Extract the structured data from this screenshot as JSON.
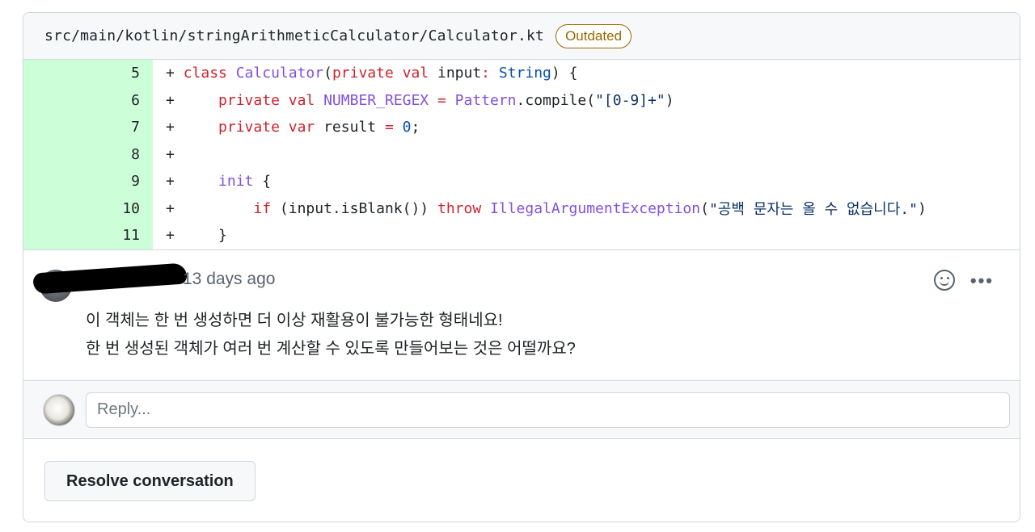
{
  "file": {
    "path": "src/main/kotlin/stringArithmeticCalculator/Calculator.kt",
    "badge": "Outdated"
  },
  "diff": {
    "lines": [
      {
        "number": "5",
        "sign": "+",
        "tokens": [
          {
            "t": "k",
            "v": "class "
          },
          {
            "t": "t",
            "v": "Calculator"
          },
          {
            "t": "p",
            "v": "("
          },
          {
            "t": "k",
            "v": "private val "
          },
          {
            "t": "p",
            "v": "input"
          },
          {
            "t": "k",
            "v": ": "
          },
          {
            "t": "c",
            "v": "String"
          },
          {
            "t": "p",
            "v": ") {"
          }
        ]
      },
      {
        "number": "6",
        "sign": "+",
        "tokens": [
          {
            "t": "p",
            "v": "    "
          },
          {
            "t": "k",
            "v": "private val "
          },
          {
            "t": "t",
            "v": "NUMBER_REGEX"
          },
          {
            "t": "k",
            "v": " = "
          },
          {
            "t": "t",
            "v": "Pattern"
          },
          {
            "t": "p",
            "v": ".compile("
          },
          {
            "t": "s",
            "v": "\"[0-9]+\""
          },
          {
            "t": "p",
            "v": ")"
          }
        ]
      },
      {
        "number": "7",
        "sign": "+",
        "tokens": [
          {
            "t": "p",
            "v": "    "
          },
          {
            "t": "k",
            "v": "private var "
          },
          {
            "t": "p",
            "v": "result "
          },
          {
            "t": "k",
            "v": "= "
          },
          {
            "t": "c",
            "v": "0"
          },
          {
            "t": "p",
            "v": ";"
          }
        ]
      },
      {
        "number": "8",
        "sign": "+",
        "tokens": []
      },
      {
        "number": "9",
        "sign": "+",
        "tokens": [
          {
            "t": "p",
            "v": "    "
          },
          {
            "t": "t",
            "v": "init"
          },
          {
            "t": "p",
            "v": " {"
          }
        ]
      },
      {
        "number": "10",
        "sign": "+",
        "tokens": [
          {
            "t": "p",
            "v": "        "
          },
          {
            "t": "k",
            "v": "if"
          },
          {
            "t": "p",
            "v": " (input.isBlank()) "
          },
          {
            "t": "k",
            "v": "throw "
          },
          {
            "t": "t",
            "v": "IllegalArgumentException"
          },
          {
            "t": "p",
            "v": "("
          },
          {
            "t": "s",
            "v": "\"공백 문자는 올 수 없습니다.\""
          },
          {
            "t": "p",
            "v": ")"
          }
        ]
      },
      {
        "number": "11",
        "sign": "+",
        "tokens": [
          {
            "t": "p",
            "v": "    }"
          }
        ]
      }
    ]
  },
  "comment": {
    "time": "13 days ago",
    "line1": "이 객체는 한 번 생성하면 더 이상 재활용이 불가능한 형태네요!",
    "line2": "한 번 생성된 객체가 여러 번 계산할 수 있도록 만들어보는 것은 어떨까요?",
    "more_label": "•••"
  },
  "reply": {
    "placeholder": "Reply..."
  },
  "resolve_label": "Resolve conversation",
  "colors": {
    "added_line_bg": "#e6ffec",
    "added_number_bg": "#ccffd8",
    "outdated": "#9a6700"
  }
}
